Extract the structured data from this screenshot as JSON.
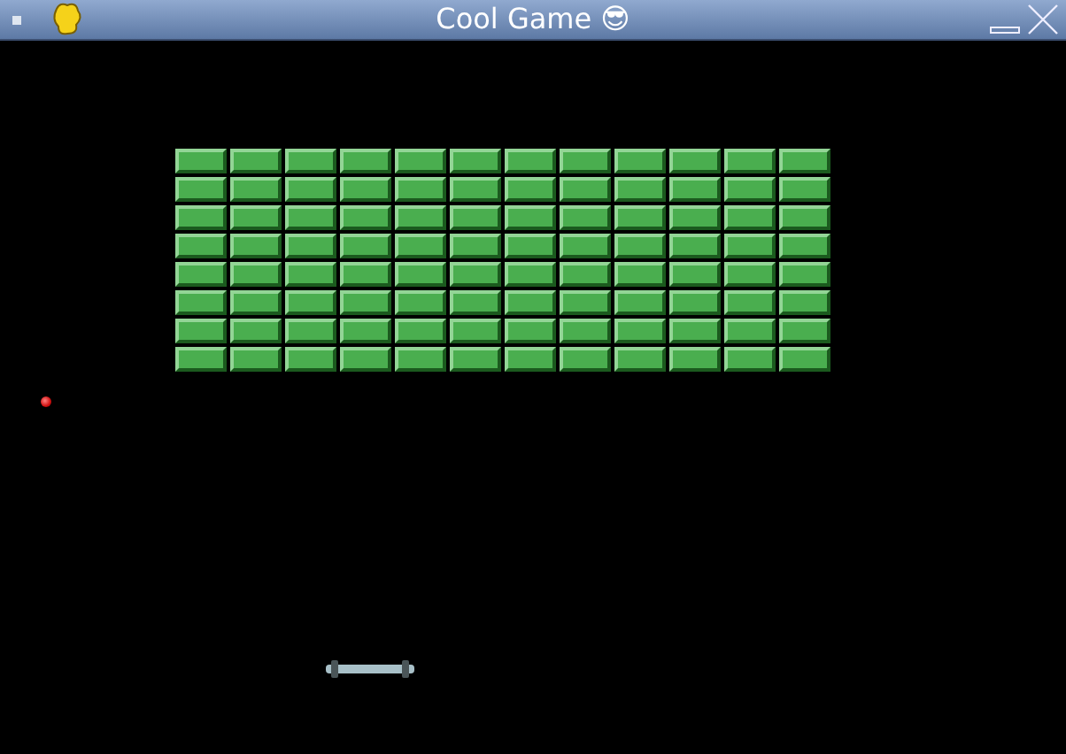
{
  "window": {
    "title": "Cool Game 😎"
  },
  "game": {
    "brick_rows": [
      [
        {
          "kind": "brick"
        },
        {
          "kind": "brick"
        },
        {
          "kind": "brick"
        },
        {
          "kind": "brick"
        },
        {
          "kind": "brick"
        },
        {
          "kind": "brick"
        },
        {
          "kind": "brick"
        },
        {
          "kind": "brick"
        },
        {
          "kind": "brick"
        },
        {
          "kind": "brick"
        },
        {
          "kind": "brick"
        },
        {
          "kind": "brick"
        }
      ],
      [
        {
          "kind": "brick"
        },
        {
          "kind": "brick"
        },
        {
          "kind": "brick"
        },
        {
          "kind": "brick"
        },
        {
          "kind": "brick"
        },
        {
          "kind": "brick"
        },
        {
          "kind": "brick"
        },
        {
          "kind": "brick"
        },
        {
          "kind": "brick"
        },
        {
          "kind": "brick"
        },
        {
          "kind": "brick"
        },
        {
          "kind": "brick"
        }
      ],
      [
        {
          "kind": "brick"
        },
        {
          "kind": "brick"
        },
        {
          "kind": "brick"
        },
        {
          "kind": "brick"
        },
        {
          "kind": "brick"
        },
        {
          "kind": "brick"
        },
        {
          "kind": "brick"
        },
        {
          "kind": "brick"
        },
        {
          "kind": "brick"
        },
        {
          "kind": "brick"
        },
        {
          "kind": "brick"
        },
        {
          "kind": "brick"
        }
      ],
      [
        {
          "kind": "brick"
        },
        {
          "kind": "brick"
        },
        {
          "kind": "brick"
        },
        {
          "kind": "brick"
        },
        {
          "kind": "brick"
        },
        {
          "kind": "brick"
        },
        {
          "kind": "brick"
        },
        {
          "kind": "brick"
        },
        {
          "kind": "brick"
        },
        {
          "kind": "brick"
        },
        {
          "kind": "brick"
        },
        {
          "kind": "brick"
        }
      ],
      [
        {
          "kind": "brick"
        },
        {
          "kind": "brick"
        },
        {
          "kind": "brick"
        },
        {
          "kind": "brick"
        },
        {
          "kind": "brick"
        },
        {
          "kind": "brick"
        },
        {
          "kind": "brick"
        },
        {
          "kind": "brick"
        },
        {
          "kind": "brick"
        },
        {
          "kind": "brick"
        },
        {
          "kind": "brick"
        },
        {
          "kind": "brick"
        }
      ],
      [
        {
          "kind": "brick"
        },
        {
          "kind": "brick"
        },
        {
          "kind": "brick"
        },
        {
          "kind": "brick"
        },
        {
          "kind": "brick"
        },
        {
          "kind": "brick"
        },
        {
          "kind": "brick"
        },
        {
          "kind": "brick"
        },
        {
          "kind": "brick"
        },
        {
          "kind": "brick"
        },
        {
          "kind": "brick"
        },
        {
          "kind": "brick"
        }
      ],
      [
        {
          "kind": "brick"
        },
        {
          "kind": "brick"
        },
        {
          "kind": "brick"
        },
        {
          "kind": "brick"
        },
        {
          "kind": "brick"
        },
        {
          "kind": "brick"
        },
        {
          "kind": "brick"
        },
        {
          "kind": "brick"
        },
        {
          "kind": "brick"
        },
        {
          "kind": "brick"
        },
        {
          "kind": "brick"
        },
        {
          "kind": "brick"
        }
      ],
      [
        {
          "kind": "brick"
        },
        {
          "kind": "brick"
        },
        {
          "kind": "brick"
        },
        {
          "kind": "brick"
        },
        {
          "kind": "brick"
        },
        {
          "kind": "brick"
        },
        {
          "kind": "brick"
        },
        {
          "kind": "brick"
        },
        {
          "kind": "brick"
        },
        {
          "kind": "brick"
        },
        {
          "kind": "brick"
        },
        {
          "kind": "brick"
        }
      ]
    ]
  }
}
